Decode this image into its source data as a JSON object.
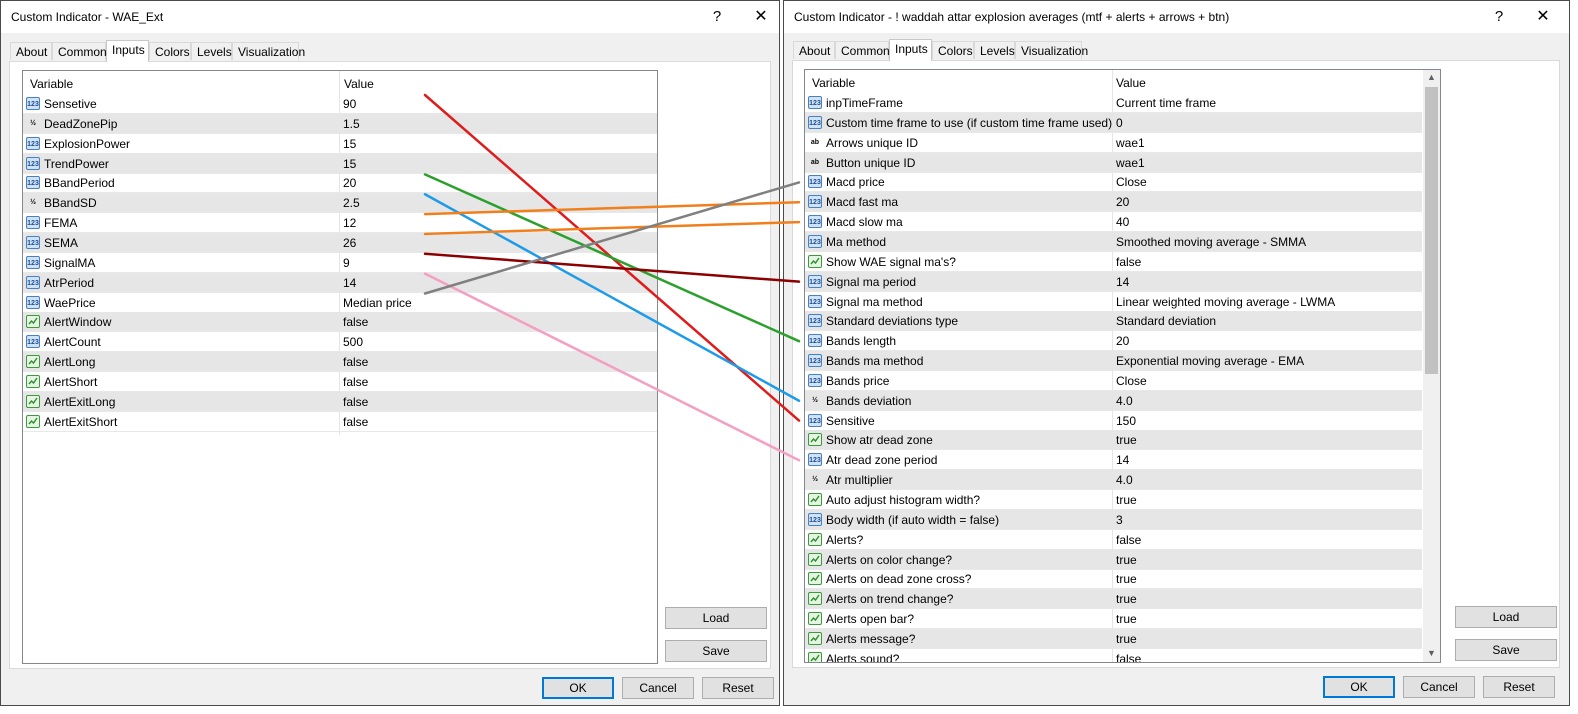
{
  "left_window": {
    "title": "Custom Indicator - WAE_Ext",
    "help_glyph": "?",
    "close_glyph": "✕",
    "tabs": [
      "About",
      "Common",
      "Inputs",
      "Colors",
      "Levels",
      "Visualization"
    ],
    "active_tab": "Inputs",
    "grid": {
      "col_variable": "Variable",
      "col_value": "Value",
      "rows": [
        {
          "icon": "int",
          "name": "Sensetive",
          "value": "90"
        },
        {
          "icon": "double",
          "name": "DeadZonePip",
          "value": "1.5"
        },
        {
          "icon": "int",
          "name": "ExplosionPower",
          "value": "15"
        },
        {
          "icon": "int",
          "name": "TrendPower",
          "value": "15"
        },
        {
          "icon": "int",
          "name": "BBandPeriod",
          "value": "20"
        },
        {
          "icon": "double",
          "name": "BBandSD",
          "value": "2.5"
        },
        {
          "icon": "int",
          "name": "FEMA",
          "value": "12"
        },
        {
          "icon": "int",
          "name": "SEMA",
          "value": "26"
        },
        {
          "icon": "int",
          "name": "SignalMA",
          "value": "9"
        },
        {
          "icon": "int",
          "name": "AtrPeriod",
          "value": "14"
        },
        {
          "icon": "int",
          "name": "WaePrice",
          "value": "Median price"
        },
        {
          "icon": "bool",
          "name": "AlertWindow",
          "value": "false"
        },
        {
          "icon": "int",
          "name": "AlertCount",
          "value": "500"
        },
        {
          "icon": "bool",
          "name": "AlertLong",
          "value": "false"
        },
        {
          "icon": "bool",
          "name": "AlertShort",
          "value": "false"
        },
        {
          "icon": "bool",
          "name": "AlertExitLong",
          "value": "false"
        },
        {
          "icon": "bool",
          "name": "AlertExitShort",
          "value": "false"
        }
      ]
    },
    "buttons": {
      "load": "Load",
      "save": "Save",
      "ok": "OK",
      "cancel": "Cancel",
      "reset": "Reset"
    }
  },
  "right_window": {
    "title": "Custom Indicator - ! waddah attar explosion averages (mtf + alerts + arrows + btn)",
    "help_glyph": "?",
    "close_glyph": "✕",
    "tabs": [
      "About",
      "Common",
      "Inputs",
      "Colors",
      "Levels",
      "Visualization"
    ],
    "active_tab": "Inputs",
    "grid": {
      "col_variable": "Variable",
      "col_value": "Value",
      "rows": [
        {
          "icon": "enum",
          "name": "inpTimeFrame",
          "value": "Current time frame"
        },
        {
          "icon": "int",
          "name": "Custom time frame to use (if custom time frame used)",
          "value": "0"
        },
        {
          "icon": "string",
          "name": "Arrows unique ID",
          "value": "wae1"
        },
        {
          "icon": "string",
          "name": "Button unique ID",
          "value": "wae1"
        },
        {
          "icon": "int",
          "name": "Macd price",
          "value": "Close"
        },
        {
          "icon": "int",
          "name": "Macd fast ma",
          "value": "20"
        },
        {
          "icon": "int",
          "name": "Macd slow ma",
          "value": "40"
        },
        {
          "icon": "int",
          "name": "Ma method",
          "value": "Smoothed moving average - SMMA"
        },
        {
          "icon": "bool",
          "name": "Show WAE signal ma's?",
          "value": "false"
        },
        {
          "icon": "int",
          "name": "Signal ma period",
          "value": "14"
        },
        {
          "icon": "int",
          "name": "Signal ma method",
          "value": "Linear weighted moving average - LWMA"
        },
        {
          "icon": "int",
          "name": "Standard deviations type",
          "value": "Standard deviation"
        },
        {
          "icon": "int",
          "name": "Bands length",
          "value": "20"
        },
        {
          "icon": "int",
          "name": "Bands ma method",
          "value": "Exponential moving average - EMA"
        },
        {
          "icon": "int",
          "name": "Bands price",
          "value": "Close"
        },
        {
          "icon": "double",
          "name": "Bands deviation",
          "value": "4.0"
        },
        {
          "icon": "int",
          "name": "Sensitive",
          "value": "150"
        },
        {
          "icon": "bool",
          "name": "Show atr dead zone",
          "value": "true"
        },
        {
          "icon": "int",
          "name": "Atr dead zone period",
          "value": "14"
        },
        {
          "icon": "double",
          "name": "Atr multiplier",
          "value": "4.0"
        },
        {
          "icon": "bool",
          "name": "Auto adjust histogram width?",
          "value": "true"
        },
        {
          "icon": "int",
          "name": "Body width (if auto width = false)",
          "value": "3"
        },
        {
          "icon": "bool",
          "name": "Alerts?",
          "value": "false"
        },
        {
          "icon": "bool",
          "name": "Alerts on color change?",
          "value": "true"
        },
        {
          "icon": "bool",
          "name": "Alerts on dead zone cross?",
          "value": "true"
        },
        {
          "icon": "bool",
          "name": "Alerts on trend change?",
          "value": "true"
        },
        {
          "icon": "bool",
          "name": "Alerts open bar?",
          "value": "true"
        },
        {
          "icon": "bool",
          "name": "Alerts message?",
          "value": "true"
        },
        {
          "icon": "bool",
          "name": "Alerts sound?",
          "value": "false"
        }
      ]
    },
    "buttons": {
      "load": "Load",
      "save": "Save",
      "ok": "OK",
      "cancel": "Cancel",
      "reset": "Reset"
    }
  },
  "icon_labels": {
    "int": "123",
    "enum": "123",
    "double": "½",
    "string": "ab"
  },
  "mapping_lines": [
    {
      "from": "Sensetive",
      "to": "Sensitive",
      "color": "#e01b1b"
    },
    {
      "from": "BBandPeriod",
      "to": "Bands length",
      "color": "#2ca02c"
    },
    {
      "from": "BBandSD",
      "to": "Bands deviation",
      "color": "#1e9be8"
    },
    {
      "from": "FEMA",
      "to": "Macd fast ma",
      "color": "#f07f1c"
    },
    {
      "from": "SEMA",
      "to": "Macd slow ma",
      "color": "#f07f1c"
    },
    {
      "from": "SignalMA",
      "to": "Signal ma period",
      "color": "#8b0000"
    },
    {
      "from": "AtrPeriod",
      "to": "Atr dead zone period",
      "color": "#f4a0c0"
    },
    {
      "from": "WaePrice",
      "to": "Macd price",
      "color": "#808080"
    }
  ]
}
